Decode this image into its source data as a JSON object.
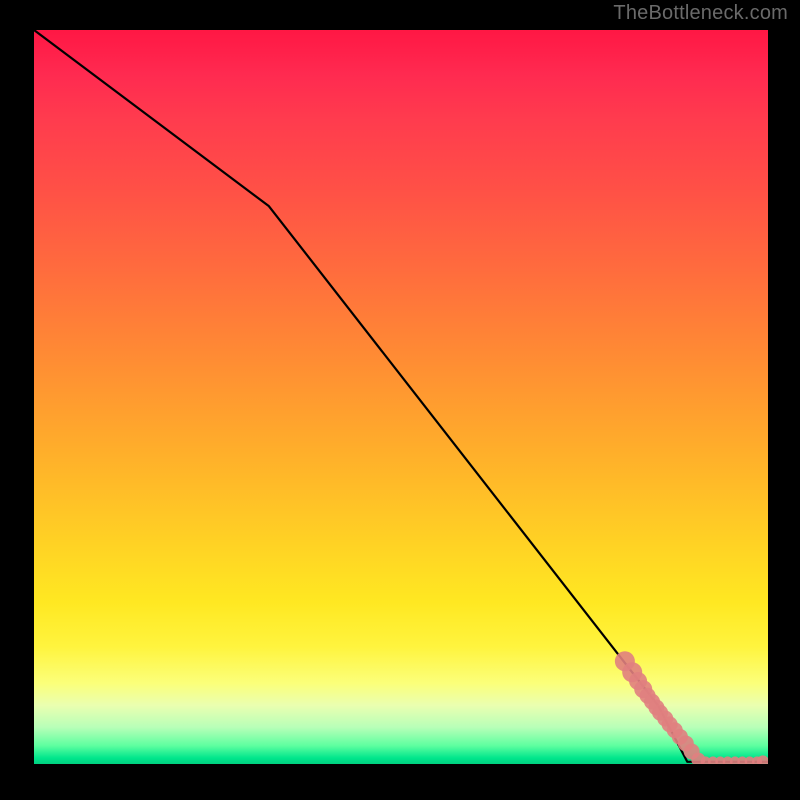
{
  "watermark": "TheBottleneck.com",
  "chart_data": {
    "type": "line",
    "title": "",
    "xlabel": "",
    "ylabel": "",
    "xlim": [
      0,
      100
    ],
    "ylim": [
      0,
      100
    ],
    "grid": false,
    "legend": false,
    "series": [
      {
        "name": "curve",
        "type": "line",
        "color": "#000000",
        "x": [
          0,
          32,
          85,
          89,
          100
        ],
        "values": [
          100,
          76,
          8,
          0.3,
          0.3
        ]
      },
      {
        "name": "points",
        "type": "scatter",
        "color": "#e08080",
        "x": [
          80.5,
          81.5,
          82.3,
          83.0,
          83.6,
          84.2,
          84.8,
          85.3,
          86.0,
          86.6,
          87.3,
          88.0,
          88.8,
          89.6,
          90.5,
          91.5,
          92.5,
          93.5,
          94.5,
          95.5,
          96.5,
          97.5,
          98.5,
          99.3
        ],
        "values": [
          14.0,
          12.5,
          11.3,
          10.2,
          9.3,
          8.5,
          7.7,
          7.0,
          6.2,
          5.4,
          4.6,
          3.7,
          2.8,
          1.7,
          0.6,
          0.35,
          0.35,
          0.35,
          0.35,
          0.35,
          0.35,
          0.35,
          0.35,
          0.35
        ],
        "sizes": [
          10,
          10,
          9,
          9,
          8,
          8,
          8,
          8,
          8,
          8,
          8,
          8,
          8,
          8,
          7,
          5,
          5,
          5,
          5,
          5,
          5,
          5,
          5,
          6
        ]
      }
    ],
    "background_gradient": {
      "direction": "vertical",
      "stops": [
        {
          "pos": 0.0,
          "color": "#ff1744"
        },
        {
          "pos": 0.5,
          "color": "#ffb02a"
        },
        {
          "pos": 0.85,
          "color": "#fff43e"
        },
        {
          "pos": 1.0,
          "color": "#00d080"
        }
      ]
    }
  }
}
